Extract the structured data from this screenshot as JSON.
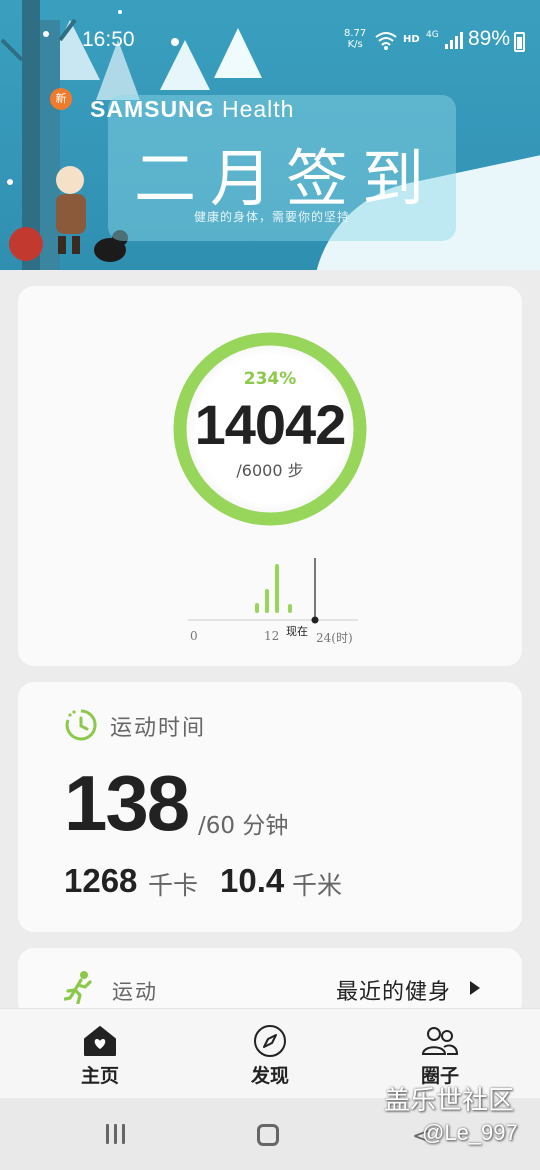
{
  "status_bar": {
    "time": "16:50",
    "net_speed_value": "8.77",
    "net_speed_unit": "K/s",
    "hd": "HD",
    "network": "4G",
    "battery": "89%"
  },
  "banner": {
    "brand_bold": "SAMSUNG",
    "brand_light": "Health",
    "title": "二月签到",
    "subtitle": "健康的身体，需要你的坚持",
    "new_badge": "新"
  },
  "steps_card": {
    "percent": "234%",
    "steps": "14042",
    "goal": "/6000 步",
    "progress": 2.34,
    "accent_color": "#97d65a",
    "hourly_chart": {
      "axis_start": "0",
      "axis_mid": "12",
      "axis_end": "24(时)",
      "now_label": "现在"
    }
  },
  "activity_card": {
    "title": "运动时间",
    "minutes": "138",
    "goal": "/60 分钟",
    "calories": "1268",
    "calories_unit": "千卡",
    "distance": "10.4",
    "distance_unit": "千米"
  },
  "exercise_card": {
    "title": "运动",
    "recent": "最近的健身"
  },
  "bottom_nav": {
    "items": [
      {
        "label": "主页",
        "icon": "home-heart-icon"
      },
      {
        "label": "发现",
        "icon": "compass-icon"
      },
      {
        "label": "圈子",
        "icon": "people-icon"
      }
    ]
  },
  "watermark": {
    "line1": "盖乐世社区",
    "line2": "@Le_997"
  }
}
